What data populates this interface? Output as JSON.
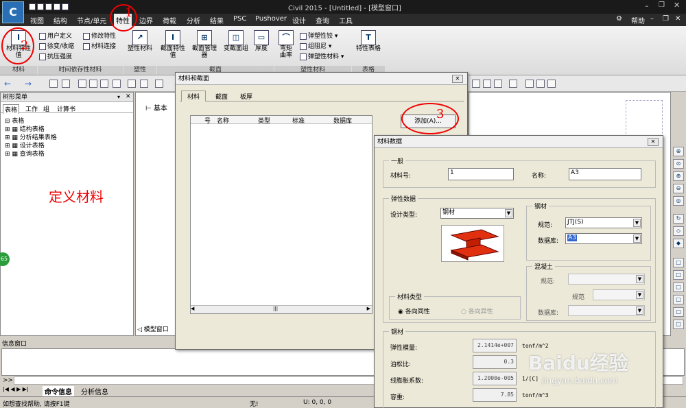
{
  "window": {
    "title": "Civil 2015 - [Untitled] - [模型窗口]",
    "help_label": "帮助"
  },
  "menu": [
    "视图",
    "结构",
    "节点/单元",
    "特性",
    "边界",
    "荷载",
    "分析",
    "结果",
    "PSC",
    "Pushover",
    "设计",
    "查询",
    "工具"
  ],
  "ribbon": {
    "buttons": [
      {
        "label": "材料特性\n值"
      },
      {
        "label": "用户定义"
      },
      {
        "label": "徐变/收缩"
      },
      {
        "label": "抗压强度"
      },
      {
        "label": "修改特性"
      },
      {
        "label": "材料连接"
      },
      {
        "label": "塑性材料"
      },
      {
        "label": "截面特性\n值"
      },
      {
        "label": "截面管理\n器"
      },
      {
        "label": "变截面组"
      },
      {
        "label": "厚度"
      },
      {
        "label": "弯矩\n曲率"
      },
      {
        "label": "弹塑性铰"
      },
      {
        "label": "组阻尼"
      },
      {
        "label": "弹塑性材料"
      },
      {
        "label": "特性表格"
      }
    ],
    "groups": [
      "材料",
      "时间依存性材料",
      "塑性",
      "截面",
      "塑性材料",
      "表格"
    ]
  },
  "tree": {
    "header": "树形菜单",
    "tabs": [
      "表格",
      "工作",
      "组",
      "计算书"
    ],
    "root": "表格",
    "items": [
      "结构表格",
      "分析结果表格",
      "设计表格",
      "查询表格"
    ]
  },
  "overlay_text": "定义材料",
  "view": {
    "label": "基本",
    "bottom_tab": "模型窗口"
  },
  "info": {
    "title": "信息窗口",
    "prompt": ">>",
    "tabs": [
      "命令信息",
      "分析信息"
    ],
    "status": "如想查找帮助, 请按F1键",
    "status_mid": "无!",
    "status_coords": "U: 0, 0, 0"
  },
  "badge": "65",
  "annotations": [
    "1",
    "2",
    "3"
  ],
  "dlg1": {
    "title": "材料和截面",
    "tabs": [
      "材料",
      "截面",
      "板厚"
    ],
    "columns": [
      "号",
      "名称",
      "类型",
      "标准",
      "数据库"
    ],
    "add_button": "添加(A)..."
  },
  "dlg2": {
    "title": "材料数据",
    "general_label": "一般",
    "mat_no_label": "材料号:",
    "mat_no": "1",
    "name_label": "名称:",
    "name": "A3",
    "elastic_label": "弹性数据",
    "design_type_label": "设计类型:",
    "design_type": "钢材",
    "steel_group": "钢材",
    "code_label": "规范:",
    "code_value": "JTJ(S)",
    "db_label": "数据库:",
    "db_value": "A3",
    "concrete_group": "混凝土",
    "conc_code_label": "规范:",
    "conc_code2_label": "规范",
    "conc_db_label": "数据库:",
    "mat_type_label": "材料类型",
    "iso": "各向同性",
    "aniso": "各向异性",
    "steel_section": "钢材",
    "props": [
      {
        "label": "弹性模量:",
        "value": "2.1414e+007",
        "unit": "tonf/m^2"
      },
      {
        "label": "泊松比:",
        "value": "0.3",
        "unit": ""
      },
      {
        "label": "线膨胀系数:",
        "value": "1.2000e-005",
        "unit": "1/[C]"
      },
      {
        "label": "容重:",
        "value": "7.85",
        "unit": "tonf/m^3"
      }
    ]
  },
  "watermark": {
    "brand": "Baidu经验",
    "url": "jingyan.baidu.com"
  }
}
